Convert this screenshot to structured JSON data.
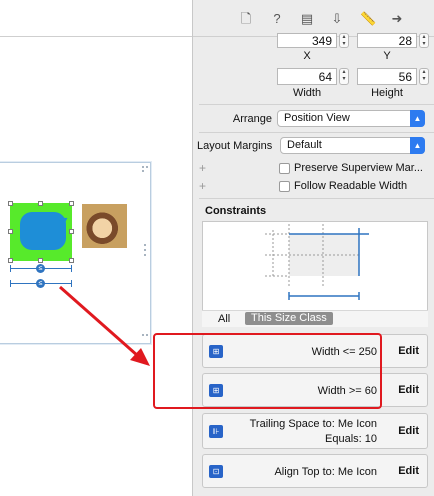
{
  "tabs": [
    {
      "name": "file-icon",
      "glyph": "🗋"
    },
    {
      "name": "help-icon",
      "glyph": "?"
    },
    {
      "name": "identity-icon",
      "glyph": "▤"
    },
    {
      "name": "attributes-icon",
      "glyph": "⇩"
    },
    {
      "name": "size-icon",
      "glyph": "📏"
    },
    {
      "name": "connections-icon",
      "glyph": "➜"
    }
  ],
  "frame": {
    "x_value": "349",
    "x_label": "X",
    "y_value": "28",
    "y_label": "Y",
    "width_value": "64",
    "width_label": "Width",
    "height_value": "56",
    "height_label": "Height"
  },
  "arrange": {
    "label": "Arrange",
    "value": "Position View"
  },
  "layout_margins": {
    "label": "Layout Margins",
    "value": "Default"
  },
  "options": {
    "preserve_superview": "Preserve Superview Mar...",
    "follow_readable": "Follow Readable Width"
  },
  "constraints": {
    "title": "Constraints",
    "tab_all": "All",
    "tab_size_class": "This Size Class",
    "items": [
      {
        "line1": "Width <=  250",
        "line2": "",
        "edit": "Edit"
      },
      {
        "line1": "Width >=  60",
        "line2": "",
        "edit": "Edit"
      },
      {
        "line1": "Trailing Space to:  Me Icon",
        "line2": "Equals:  10",
        "edit": "Edit"
      },
      {
        "line1": "Align Top to:  Me Icon",
        "line2": "",
        "edit": "Edit"
      }
    ]
  },
  "canvas": {
    "constraint_badge": "≤"
  },
  "colors": {
    "accent": "#2d7bf0",
    "highlight": "#e0191f",
    "view_green": "#57ea2b",
    "bubble_blue": "#1e8ed7"
  }
}
